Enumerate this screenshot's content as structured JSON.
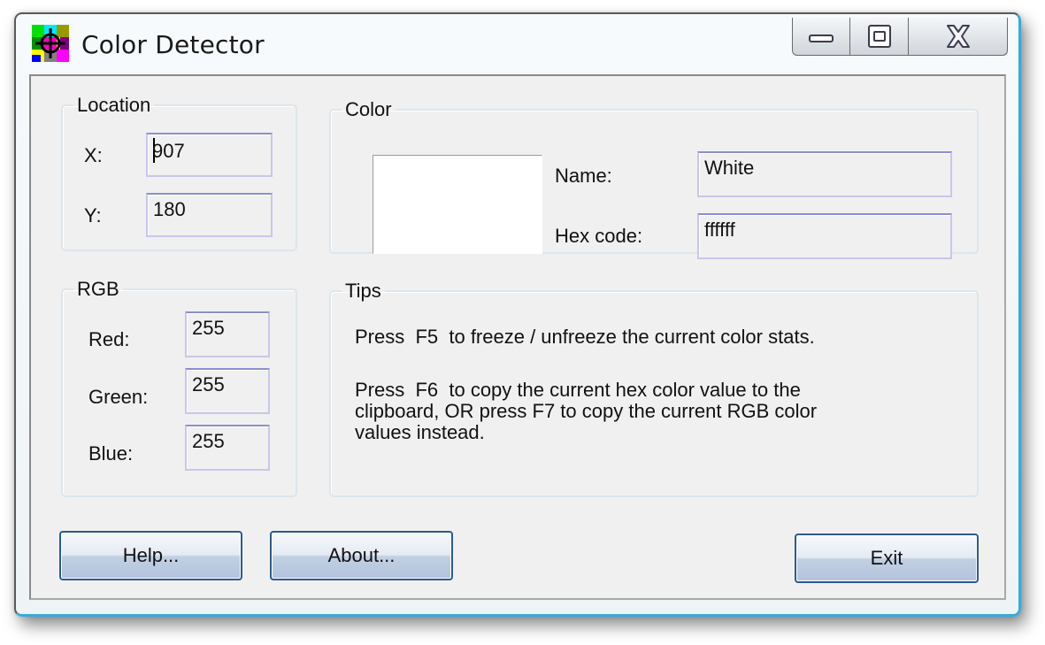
{
  "window": {
    "title": "Color Detector",
    "app_icon": "color-detector-crosshair-icon",
    "caption_buttons": [
      {
        "name": "minimize",
        "icon": "minimize-icon"
      },
      {
        "name": "maximize",
        "icon": "maximize-icon"
      },
      {
        "name": "close",
        "icon": "close-icon"
      }
    ]
  },
  "location": {
    "legend": "Location",
    "x_label": "X:",
    "x_value": "907",
    "y_label": "Y:",
    "y_value": "180"
  },
  "color": {
    "legend": "Color",
    "swatch_color": "#ffffff",
    "name_label": "Name:",
    "name_value": "White",
    "hex_label": "Hex code:",
    "hex_value": "ffffff"
  },
  "rgb": {
    "legend": "RGB",
    "red_label": "Red:",
    "red_value": "255",
    "green_label": "Green:",
    "green_value": "255",
    "blue_label": "Blue:",
    "blue_value": "255"
  },
  "tips": {
    "legend": "Tips",
    "tip1": "Press  F5  to freeze / unfreeze the current color stats.",
    "tip2_line1": "Press  F6  to copy the current hex color value to the",
    "tip2_line2": "clipboard, OR press F7 to copy the current RGB color",
    "tip2_line3": "values instead."
  },
  "buttons": {
    "help": "Help...",
    "about": "About...",
    "exit": "Exit"
  },
  "colors": {
    "window_accent": "#3aa9d8",
    "button_border": "#2c5a8e",
    "field_border": "#8d8dd0",
    "dialog_bg": "#f0f0f0"
  }
}
